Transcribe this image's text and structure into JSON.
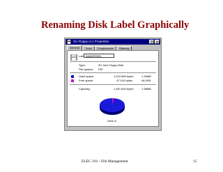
{
  "slide": {
    "title": "Renaming Disk Label Graphically",
    "footer_left": "ELEC 101 - File Management",
    "page_number": "15"
  },
  "window": {
    "title": "3½ Floppy (A:) Properties",
    "help_button": "?",
    "close_button": "×",
    "tabs": [
      "General",
      "Tools",
      "Compression",
      "Sharing"
    ],
    "active_tab": "General"
  },
  "general": {
    "label_caption": "Label:",
    "label_value": "ANDERSEN",
    "type_caption": "Type:",
    "type_value": "3½ Inch Floppy Disk",
    "fs_caption": "File system:",
    "fs_value": "FAT",
    "used_caption": "Used space:",
    "used_bytes": "1,410,560 bytes",
    "used_mb": "1.34MB",
    "free_caption": "Free space:",
    "free_bytes": "47,104 bytes",
    "free_mb": "46.0KB",
    "capacity_caption": "Capacity:",
    "capacity_bytes": "1,457,664 bytes",
    "capacity_mb": "1.38MB",
    "drive_caption": "Drive A"
  },
  "colors": {
    "title": "#8b0000",
    "used": "#1010c8",
    "free": "#c010c0",
    "titlebar": "#000080"
  },
  "icons": [
    "floppy-icon",
    "drive-icon"
  ]
}
